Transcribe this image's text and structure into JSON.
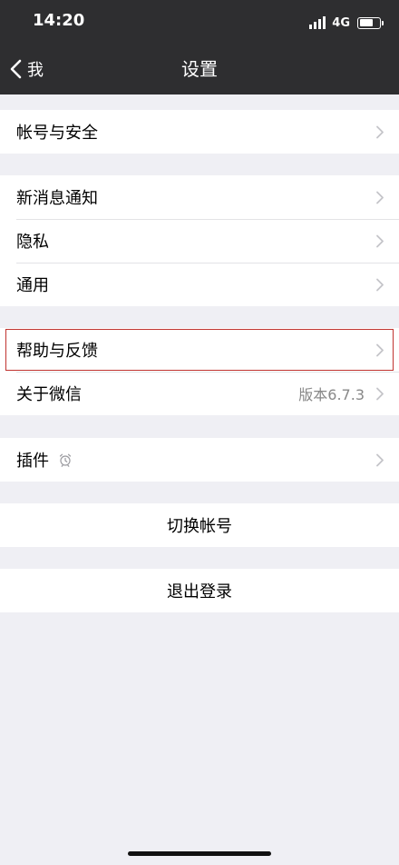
{
  "status_bar": {
    "time": "14:20",
    "network": "4G",
    "battery_level": 0.7
  },
  "nav": {
    "back_label": "我",
    "title": "设置"
  },
  "groups": [
    {
      "items": [
        {
          "label": "帐号与安全"
        }
      ]
    },
    {
      "items": [
        {
          "label": "新消息通知"
        },
        {
          "label": "隐私"
        },
        {
          "label": "通用"
        }
      ]
    },
    {
      "items": [
        {
          "label": "帮助与反馈",
          "highlighted": true
        },
        {
          "label": "关于微信",
          "value": "版本6.7.3"
        }
      ]
    },
    {
      "items": [
        {
          "label": "插件",
          "icon": "plugin-alarm-icon"
        }
      ]
    }
  ],
  "actions": {
    "switch_account": "切换帐号",
    "logout": "退出登录"
  },
  "colors": {
    "nav_background": "#2e2e30",
    "page_background": "#efeff4",
    "highlight_border": "#c0332f"
  }
}
